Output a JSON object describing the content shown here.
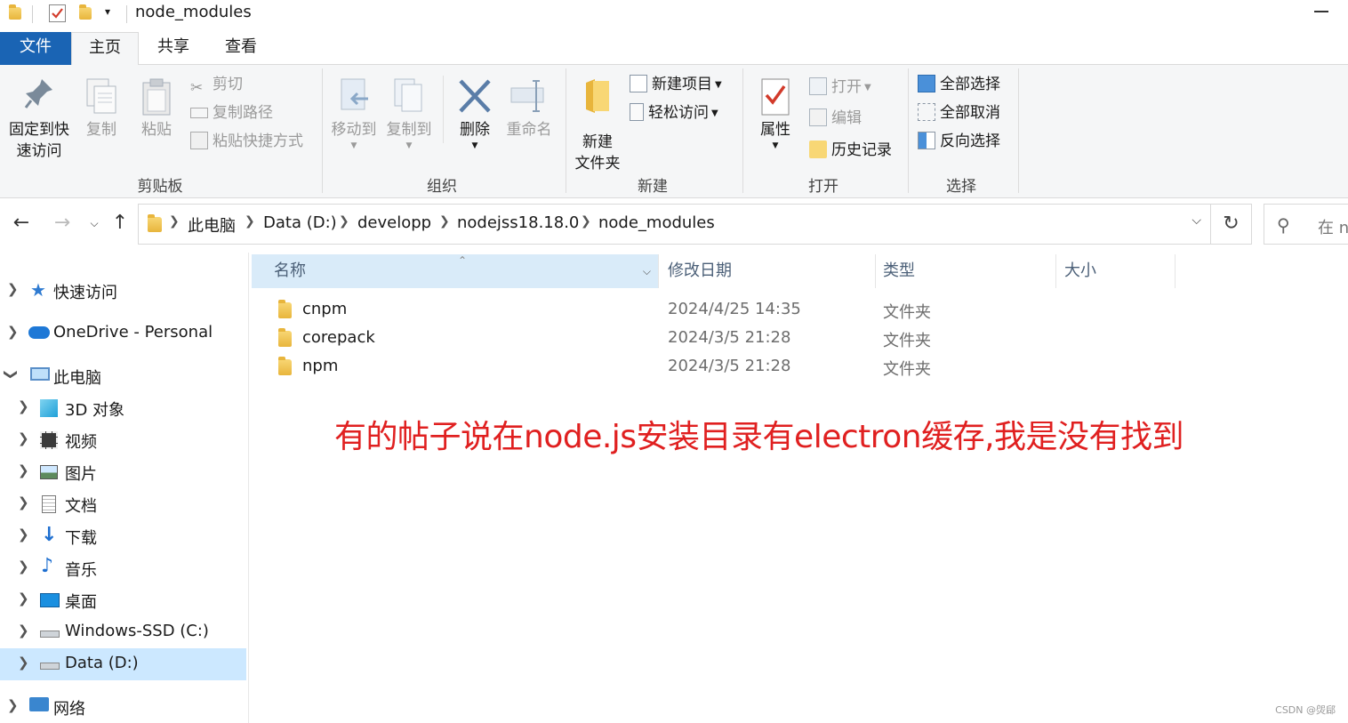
{
  "window": {
    "title": "node_modules"
  },
  "ribbon_tabs": [
    "文件",
    "主页",
    "共享",
    "查看"
  ],
  "ribbon": {
    "clipboard": {
      "pin": "固定到快速访问",
      "pin_line1": "固定到快",
      "pin_line2": "速访问",
      "copy": "复制",
      "paste": "粘贴",
      "cut": "剪切",
      "copy_path": "复制路径",
      "paste_shortcut": "粘贴快捷方式",
      "group_label": "剪贴板"
    },
    "organize": {
      "move_to": "移动到",
      "copy_to": "复制到",
      "delete": "删除",
      "rename": "重命名",
      "group_label": "组织"
    },
    "new": {
      "new_folder_line1": "新建",
      "new_folder_line2": "文件夹",
      "new_item": "新建项目",
      "easy_access": "轻松访问",
      "group_label": "新建"
    },
    "open": {
      "properties": "属性",
      "open": "打开",
      "edit": "编辑",
      "history": "历史记录",
      "group_label": "打开"
    },
    "select": {
      "select_all": "全部选择",
      "select_none": "全部取消",
      "invert": "反向选择",
      "group_label": "选择"
    }
  },
  "address": {
    "crumbs": [
      "此电脑",
      "Data (D:)",
      "developp",
      "nodejss18.18.0",
      "node_modules"
    ],
    "search_placeholder": "在 n"
  },
  "navpane": {
    "items": [
      {
        "label": "快速访问",
        "icon": "star-icon"
      },
      {
        "label": "OneDrive - Personal",
        "icon": "cloud-icon"
      },
      {
        "label": "此电脑",
        "icon": "computer-icon"
      },
      {
        "label": "3D 对象",
        "icon": "cube-icon"
      },
      {
        "label": "视频",
        "icon": "film-icon"
      },
      {
        "label": "图片",
        "icon": "picture-icon"
      },
      {
        "label": "文档",
        "icon": "document-icon"
      },
      {
        "label": "下载",
        "icon": "download-icon"
      },
      {
        "label": "音乐",
        "icon": "music-icon"
      },
      {
        "label": "桌面",
        "icon": "desktop-icon"
      },
      {
        "label": "Windows-SSD (C:)",
        "icon": "drive-icon"
      },
      {
        "label": "Data (D:)",
        "icon": "drive-icon"
      },
      {
        "label": "网络",
        "icon": "network-icon"
      }
    ]
  },
  "filelist": {
    "columns": [
      "名称",
      "修改日期",
      "类型",
      "大小"
    ],
    "rows": [
      {
        "name": "cnpm",
        "date": "2024/4/25 14:35",
        "type": "文件夹"
      },
      {
        "name": "corepack",
        "date": "2024/3/5 21:28",
        "type": "文件夹"
      },
      {
        "name": "npm",
        "date": "2024/3/5 21:28",
        "type": "文件夹"
      }
    ]
  },
  "annotation": "有的帖子说在node.js安装目录有electron缓存,我是没有找到",
  "watermark": "CSDN @焈郈",
  "colors": {
    "file_tab": "#1a64b4",
    "selected": "#cce8ff",
    "header": "#d9ebf9",
    "annotation": "#e02020"
  }
}
